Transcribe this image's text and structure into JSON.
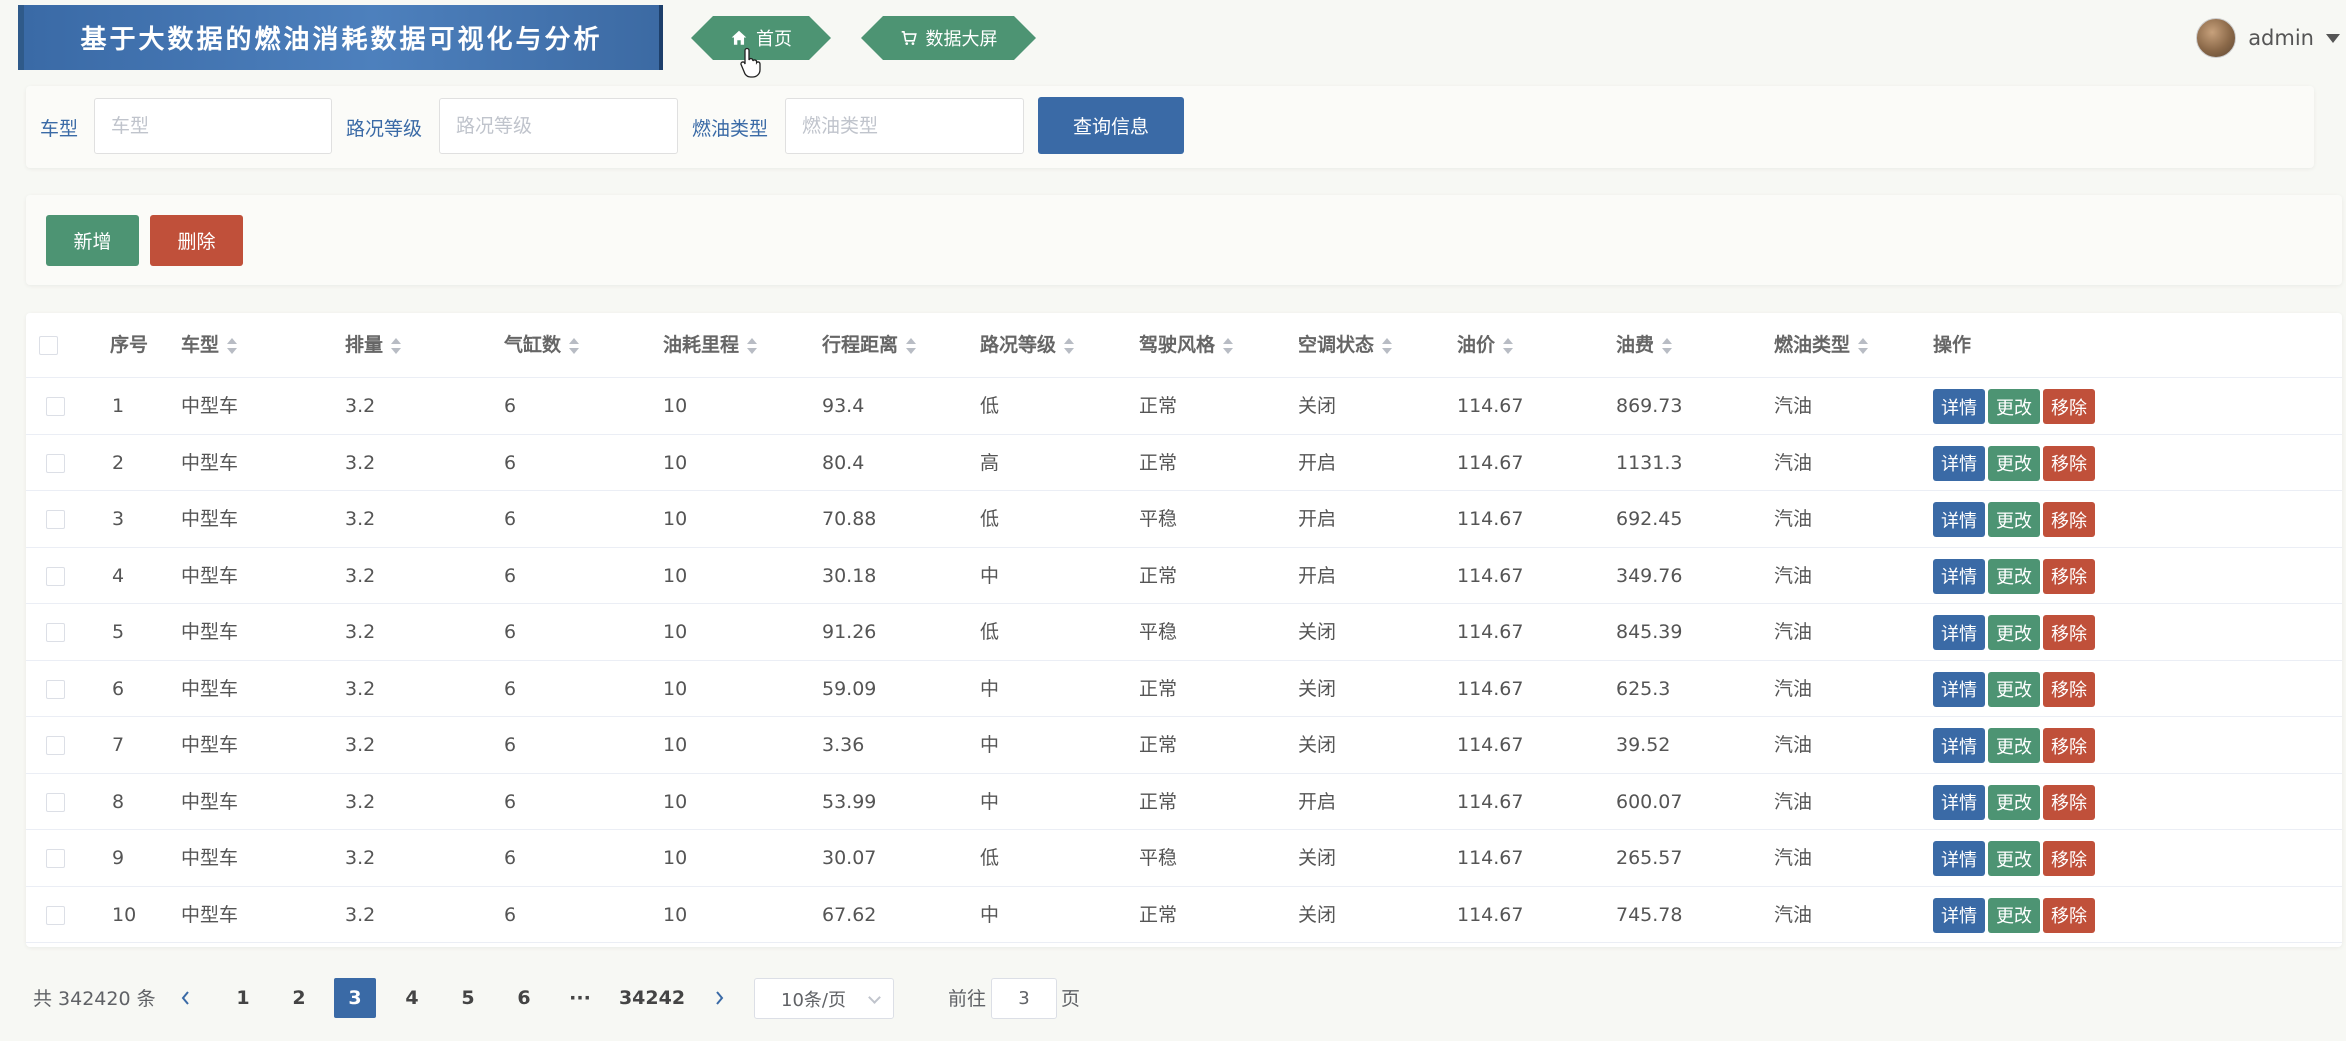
{
  "header": {
    "title": "基于大数据的燃油消耗数据可视化与分析",
    "nav": [
      {
        "label": "首页",
        "icon": "home-icon"
      },
      {
        "label": "数据大屏",
        "icon": "cart-icon"
      }
    ],
    "username": "admin"
  },
  "search": {
    "fields": [
      {
        "label": "车型",
        "placeholder": "车型",
        "value": ""
      },
      {
        "label": "路况等级",
        "placeholder": "路况等级",
        "value": ""
      },
      {
        "label": "燃油类型",
        "placeholder": "燃油类型",
        "value": ""
      }
    ],
    "query_label": "查询信息"
  },
  "actions": {
    "add_label": "新增",
    "delete_label": "删除"
  },
  "table": {
    "columns": [
      "序号",
      "车型",
      "排量",
      "气缸数",
      "油耗里程",
      "行程距离",
      "路况等级",
      "驾驶风格",
      "空调状态",
      "油价",
      "油费",
      "燃油类型",
      "操作"
    ],
    "op_labels": {
      "detail": "详情",
      "edit": "更改",
      "remove": "移除"
    },
    "rows": [
      [
        "1",
        "中型车",
        "3.2",
        "6",
        "10",
        "93.4",
        "低",
        "正常",
        "关闭",
        "114.67",
        "869.73",
        "汽油"
      ],
      [
        "2",
        "中型车",
        "3.2",
        "6",
        "10",
        "80.4",
        "高",
        "正常",
        "开启",
        "114.67",
        "1131.3",
        "汽油"
      ],
      [
        "3",
        "中型车",
        "3.2",
        "6",
        "10",
        "70.88",
        "低",
        "平稳",
        "开启",
        "114.67",
        "692.45",
        "汽油"
      ],
      [
        "4",
        "中型车",
        "3.2",
        "6",
        "10",
        "30.18",
        "中",
        "正常",
        "开启",
        "114.67",
        "349.76",
        "汽油"
      ],
      [
        "5",
        "中型车",
        "3.2",
        "6",
        "10",
        "91.26",
        "低",
        "平稳",
        "关闭",
        "114.67",
        "845.39",
        "汽油"
      ],
      [
        "6",
        "中型车",
        "3.2",
        "6",
        "10",
        "59.09",
        "中",
        "正常",
        "关闭",
        "114.67",
        "625.3",
        "汽油"
      ],
      [
        "7",
        "中型车",
        "3.2",
        "6",
        "10",
        "3.36",
        "中",
        "正常",
        "关闭",
        "114.67",
        "39.52",
        "汽油"
      ],
      [
        "8",
        "中型车",
        "3.2",
        "6",
        "10",
        "53.99",
        "中",
        "正常",
        "开启",
        "114.67",
        "600.07",
        "汽油"
      ],
      [
        "9",
        "中型车",
        "3.2",
        "6",
        "10",
        "30.07",
        "低",
        "平稳",
        "关闭",
        "114.67",
        "265.57",
        "汽油"
      ],
      [
        "10",
        "中型车",
        "3.2",
        "6",
        "10",
        "67.62",
        "中",
        "正常",
        "关闭",
        "114.67",
        "745.78",
        "汽油"
      ]
    ]
  },
  "pagination": {
    "total_text": "共 342420 条",
    "pages": [
      "1",
      "2",
      "3",
      "4",
      "5",
      "6",
      "···",
      "34242"
    ],
    "current_page": "3",
    "page_size_label": "10条/页",
    "goto_prefix": "前往",
    "goto_value": "3",
    "goto_suffix": "页"
  },
  "colors": {
    "primary": "#3a6aa6",
    "success": "#4d9473",
    "danger": "#c0503a"
  }
}
